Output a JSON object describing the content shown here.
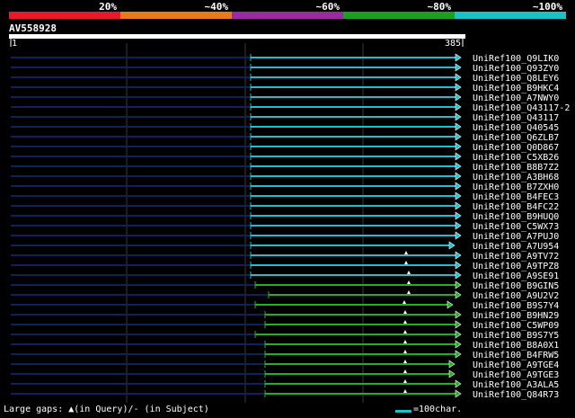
{
  "legend": {
    "segments": [
      {
        "label": "20%",
        "color": "#e8192c"
      },
      {
        "label": "~40%",
        "color": "#e87a1c"
      },
      {
        "label": "~60%",
        "color": "#9a2a9e"
      },
      {
        "label": "~80%",
        "color": "#1ca01c"
      },
      {
        "label": "~100%",
        "color": "#1cc0c8"
      }
    ]
  },
  "query": {
    "name": "AV558928",
    "start": "1",
    "end": "385"
  },
  "colors": {
    "cyan": "#1cc0d0",
    "green": "#22b022",
    "navy": "#10205a",
    "grid": "#3a3a3a"
  },
  "hits": [
    {
      "name": "UniRef100_Q9LIK0",
      "color": "cyan",
      "start": 279,
      "end": 513,
      "marker": null
    },
    {
      "name": "UniRef100_Q93ZY0",
      "color": "cyan",
      "start": 279,
      "end": 513,
      "marker": null
    },
    {
      "name": "UniRef100_Q8LEY6",
      "color": "cyan",
      "start": 279,
      "end": 513,
      "marker": null
    },
    {
      "name": "UniRef100_B9HKC4",
      "color": "cyan",
      "start": 279,
      "end": 513,
      "marker": null
    },
    {
      "name": "UniRef100_A7NWY0",
      "color": "cyan",
      "start": 279,
      "end": 513,
      "marker": null
    },
    {
      "name": "UniRef100_Q43117-2",
      "color": "cyan",
      "start": 279,
      "end": 513,
      "marker": null
    },
    {
      "name": "UniRef100_Q43117",
      "color": "cyan",
      "start": 279,
      "end": 513,
      "marker": null
    },
    {
      "name": "UniRef100_Q40545",
      "color": "cyan",
      "start": 279,
      "end": 513,
      "marker": null
    },
    {
      "name": "UniRef100_Q6ZLB7",
      "color": "cyan",
      "start": 279,
      "end": 513,
      "marker": null
    },
    {
      "name": "UniRef100_Q0D867",
      "color": "cyan",
      "start": 279,
      "end": 513,
      "marker": null
    },
    {
      "name": "UniRef100_C5XB26",
      "color": "cyan",
      "start": 279,
      "end": 513,
      "marker": null
    },
    {
      "name": "UniRef100_B8B7Z2",
      "color": "cyan",
      "start": 279,
      "end": 513,
      "marker": null
    },
    {
      "name": "UniRef100_A3BH68",
      "color": "cyan",
      "start": 279,
      "end": 513,
      "marker": null
    },
    {
      "name": "UniRef100_B7ZXH0",
      "color": "cyan",
      "start": 279,
      "end": 513,
      "marker": null
    },
    {
      "name": "UniRef100_B4FEC3",
      "color": "cyan",
      "start": 279,
      "end": 513,
      "marker": null
    },
    {
      "name": "UniRef100_B4FC22",
      "color": "cyan",
      "start": 279,
      "end": 513,
      "marker": null
    },
    {
      "name": "UniRef100_B9HUQ0",
      "color": "cyan",
      "start": 279,
      "end": 513,
      "marker": null
    },
    {
      "name": "UniRef100_C5WX73",
      "color": "cyan",
      "start": 279,
      "end": 513,
      "marker": null
    },
    {
      "name": "UniRef100_A7PUJ0",
      "color": "cyan",
      "start": 279,
      "end": 513,
      "marker": null
    },
    {
      "name": "UniRef100_A7U954",
      "color": "cyan",
      "start": 279,
      "end": 506,
      "marker": null
    },
    {
      "name": "UniRef100_A9TV72",
      "color": "cyan",
      "start": 279,
      "end": 513,
      "marker": 452
    },
    {
      "name": "UniRef100_A9TPZ8",
      "color": "cyan",
      "start": 279,
      "end": 513,
      "marker": 452
    },
    {
      "name": "UniRef100_A9SE91",
      "color": "cyan",
      "start": 279,
      "end": 513,
      "marker": 455
    },
    {
      "name": "UniRef100_B9GIN5",
      "color": "green",
      "start": 284,
      "end": 513,
      "marker": 455
    },
    {
      "name": "UniRef100_A9U2V2",
      "color": "green",
      "start": 299,
      "end": 513,
      "marker": 455
    },
    {
      "name": "UniRef100_B9S7Y4",
      "color": "green",
      "start": 284,
      "end": 504,
      "marker": 450
    },
    {
      "name": "UniRef100_B9HN29",
      "color": "green",
      "start": 295,
      "end": 513,
      "marker": 451
    },
    {
      "name": "UniRef100_C5WP09",
      "color": "green",
      "start": 295,
      "end": 513,
      "marker": 451
    },
    {
      "name": "UniRef100_B9S7Y5",
      "color": "green",
      "start": 284,
      "end": 513,
      "marker": 451
    },
    {
      "name": "UniRef100_B8A0X1",
      "color": "green",
      "start": 295,
      "end": 513,
      "marker": 451
    },
    {
      "name": "UniRef100_B4FRW5",
      "color": "green",
      "start": 295,
      "end": 513,
      "marker": 451
    },
    {
      "name": "UniRef100_A9TGE4",
      "color": "green",
      "start": 295,
      "end": 506,
      "marker": 451
    },
    {
      "name": "UniRef100_A9TGE3",
      "color": "green",
      "start": 295,
      "end": 506,
      "marker": 451
    },
    {
      "name": "UniRef100_A3ALA5",
      "color": "green",
      "start": 295,
      "end": 513,
      "marker": 451
    },
    {
      "name": "UniRef100_Q84R73",
      "color": "green",
      "start": 295,
      "end": 513,
      "marker": 451
    }
  ],
  "footer": {
    "gaps_label": "Large gaps: ▲(in Query)/- (in Subject)",
    "scale_label": "=100char."
  }
}
